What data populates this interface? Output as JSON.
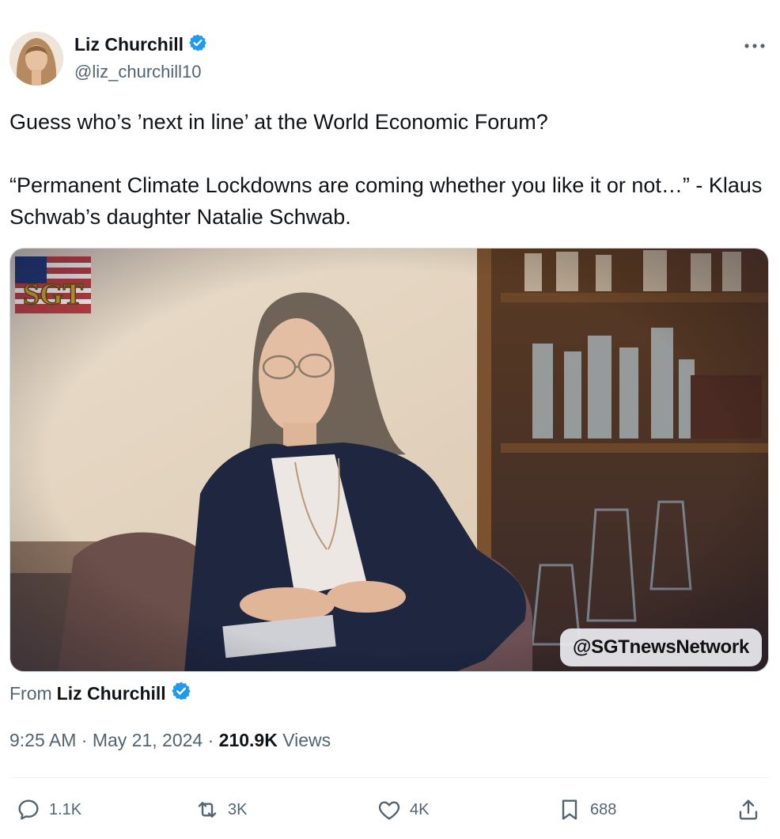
{
  "author": {
    "name": "Liz Churchill",
    "handle": "@liz_churchill10",
    "verified": true
  },
  "tweet": {
    "text": "Guess who’s ’next in line’ at the World Economic Forum?\n\n“Permanent Climate Lockdowns are coming whether you like it or not…” - Klaus Schwab’s daughter Natalie Schwab."
  },
  "media": {
    "watermark": "@SGTnewsNetwork"
  },
  "attribution": {
    "prefix": "From",
    "name": "Liz Churchill"
  },
  "meta": {
    "time": "9:25 AM",
    "separator1": "·",
    "date": "May 21, 2024",
    "separator2": "·",
    "views_count": "210.9K",
    "views_label": "Views"
  },
  "actions": {
    "replies": "1.1K",
    "reposts": "3K",
    "likes": "4K",
    "bookmarks": "688"
  },
  "colors": {
    "verified": "#1d9bf0",
    "text": "#0f1419",
    "muted": "#536471"
  }
}
